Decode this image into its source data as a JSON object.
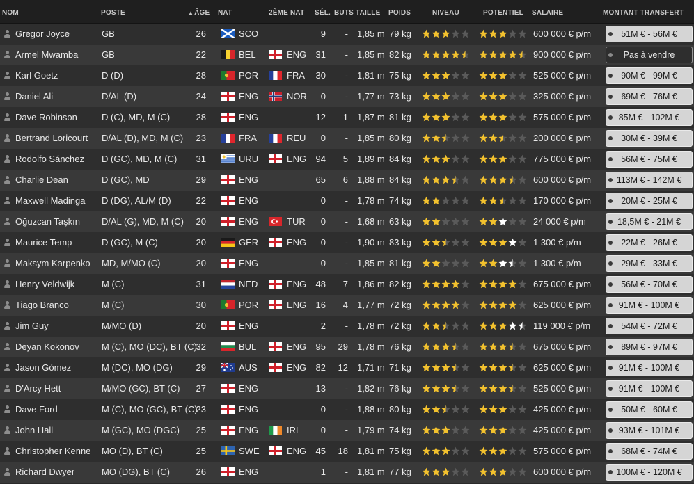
{
  "headers": {
    "nom": "NOM",
    "poste": "POSTE",
    "age": "ÂGE",
    "nat": "NAT",
    "nat2": "2ÈME NAT",
    "sel": "SÉL.",
    "buts": "BUTS",
    "taille": "TAILLE",
    "poids": "POIDS",
    "niveau": "NIVEAU",
    "potentiel": "POTENTIEL",
    "salaire": "SALAIRE",
    "transfert": "MONTANT TRANSFERT"
  },
  "colors": {
    "star": "#f2c12e",
    "star_white": "#ffffff",
    "star_empty": "#5a5a5a"
  },
  "players": [
    {
      "name": "Gregor Joyce",
      "pos": "GB",
      "age": "26",
      "nat": "SCO",
      "nat2": "",
      "sel": "9",
      "buts": "-",
      "taille": "1,85 m",
      "poids": "79 kg",
      "niveau": 3,
      "potentiel": 3,
      "pot_white": 0,
      "salaire": "600 000 € p/m",
      "transfert": "51M € - 56M €"
    },
    {
      "name": "Armel Mwamba",
      "pos": "GB",
      "age": "22",
      "nat": "BEL",
      "nat2": "ENG",
      "sel": "31",
      "buts": "-",
      "taille": "1,85 m",
      "poids": "82 kg",
      "niveau": 4.5,
      "potentiel": 4.5,
      "pot_white": 0,
      "salaire": "900 000 € p/m",
      "transfert": "Pas à vendre"
    },
    {
      "name": "Karl Goetz",
      "pos": "D (D)",
      "age": "28",
      "nat": "POR",
      "nat2": "FRA",
      "sel": "30",
      "buts": "-",
      "taille": "1,81 m",
      "poids": "75 kg",
      "niveau": 3,
      "potentiel": 3,
      "pot_white": 0,
      "salaire": "525 000 € p/m",
      "transfert": "90M € - 99M €"
    },
    {
      "name": "Daniel Ali",
      "pos": "D/AL (D)",
      "age": "24",
      "nat": "ENG",
      "nat2": "NOR",
      "sel": "0",
      "buts": "-",
      "taille": "1,77 m",
      "poids": "73 kg",
      "niveau": 3,
      "potentiel": 3,
      "pot_white": 0,
      "salaire": "325 000 € p/m",
      "transfert": "69M € - 76M €"
    },
    {
      "name": "Dave Robinson",
      "pos": "D (C), MD, M (C)",
      "age": "28",
      "nat": "ENG",
      "nat2": "",
      "sel": "12",
      "buts": "1",
      "taille": "1,87 m",
      "poids": "81 kg",
      "niveau": 3,
      "potentiel": 3,
      "pot_white": 0,
      "salaire": "575 000 € p/m",
      "transfert": "85M € - 102M €"
    },
    {
      "name": "Bertrand Loricourt",
      "pos": "D/AL (D), MD, M (C)",
      "age": "23",
      "nat": "FRA",
      "nat2": "REU",
      "sel": "0",
      "buts": "-",
      "taille": "1,85 m",
      "poids": "80 kg",
      "niveau": 2.5,
      "potentiel": 2.5,
      "pot_white": 0,
      "salaire": "200 000 € p/m",
      "transfert": "30M € - 39M €"
    },
    {
      "name": "Rodolfo Sánchez",
      "pos": "D (GC), MD, M (C)",
      "age": "31",
      "nat": "URU",
      "nat2": "ENG",
      "sel": "94",
      "buts": "5",
      "taille": "1,89 m",
      "poids": "84 kg",
      "niveau": 3,
      "potentiel": 3,
      "pot_white": 0,
      "salaire": "775 000 € p/m",
      "transfert": "56M € - 75M €"
    },
    {
      "name": "Charlie Dean",
      "pos": "D (GC), MD",
      "age": "29",
      "nat": "ENG",
      "nat2": "",
      "sel": "65",
      "buts": "6",
      "taille": "1,88 m",
      "poids": "84 kg",
      "niveau": 3.5,
      "potentiel": 3.5,
      "pot_white": 0,
      "salaire": "600 000 € p/m",
      "transfert": "113M € - 142M €"
    },
    {
      "name": "Maxwell Madinga",
      "pos": "D (DG), AL/M (D)",
      "age": "22",
      "nat": "ENG",
      "nat2": "",
      "sel": "0",
      "buts": "-",
      "taille": "1,78 m",
      "poids": "74 kg",
      "niveau": 2,
      "potentiel": 2.5,
      "pot_white": 0,
      "salaire": "170 000 € p/m",
      "transfert": "20M € - 25M €"
    },
    {
      "name": "Oğuzcan Taşkın",
      "pos": "D/AL (G), MD, M (C)",
      "age": "20",
      "nat": "ENG",
      "nat2": "TUR",
      "sel": "0",
      "buts": "-",
      "taille": "1,68 m",
      "poids": "63 kg",
      "niveau": 2,
      "potentiel": 2,
      "pot_white": 1,
      "salaire": "24 000 € p/m",
      "transfert": "18,5M € - 21M €"
    },
    {
      "name": "Maurice Temp",
      "pos": "D (GC), M (C)",
      "age": "20",
      "nat": "GER",
      "nat2": "ENG",
      "sel": "0",
      "buts": "-",
      "taille": "1,90 m",
      "poids": "83 kg",
      "niveau": 2.5,
      "potentiel": 3,
      "pot_white": 1,
      "salaire": "1 300 € p/m",
      "transfert": "22M € - 26M €"
    },
    {
      "name": "Maksym Karpenko",
      "pos": "MD, M/MO (C)",
      "age": "20",
      "nat": "ENG",
      "nat2": "",
      "sel": "0",
      "buts": "-",
      "taille": "1,85 m",
      "poids": "81 kg",
      "niveau": 2,
      "potentiel": 2,
      "pot_white": 1.5,
      "salaire": "1 300 € p/m",
      "transfert": "29M € - 33M €"
    },
    {
      "name": "Henry Veldwijk",
      "pos": "M (C)",
      "age": "31",
      "nat": "NED",
      "nat2": "ENG",
      "sel": "48",
      "buts": "7",
      "taille": "1,86 m",
      "poids": "82 kg",
      "niveau": 4,
      "potentiel": 4,
      "pot_white": 0,
      "salaire": "675 000 € p/m",
      "transfert": "56M € - 70M €"
    },
    {
      "name": "Tiago Branco",
      "pos": "M (C)",
      "age": "30",
      "nat": "POR",
      "nat2": "ENG",
      "sel": "16",
      "buts": "4",
      "taille": "1,77 m",
      "poids": "72 kg",
      "niveau": 4,
      "potentiel": 4,
      "pot_white": 0,
      "salaire": "625 000 € p/m",
      "transfert": "91M € - 100M €"
    },
    {
      "name": "Jim Guy",
      "pos": "M/MO (D)",
      "age": "20",
      "nat": "ENG",
      "nat2": "",
      "sel": "2",
      "buts": "-",
      "taille": "1,78 m",
      "poids": "72 kg",
      "niveau": 2.5,
      "potentiel": 3,
      "pot_white": 1.5,
      "salaire": "119 000 € p/m",
      "transfert": "54M € - 72M €"
    },
    {
      "name": "Deyan Kokonov",
      "pos": "M (C), MO (DC), BT (C)",
      "age": "32",
      "nat": "BUL",
      "nat2": "ENG",
      "sel": "95",
      "buts": "29",
      "taille": "1,78 m",
      "poids": "76 kg",
      "niveau": 3.5,
      "potentiel": 3.5,
      "pot_white": 0,
      "salaire": "675 000 € p/m",
      "transfert": "89M € - 97M €"
    },
    {
      "name": "Jason Gómez",
      "pos": "M (DC), MO (DG)",
      "age": "29",
      "nat": "AUS",
      "nat2": "ENG",
      "sel": "82",
      "buts": "12",
      "taille": "1,71 m",
      "poids": "71 kg",
      "niveau": 3.5,
      "potentiel": 3.5,
      "pot_white": 0,
      "salaire": "625 000 € p/m",
      "transfert": "91M € - 100M €"
    },
    {
      "name": "D'Arcy Hett",
      "pos": "M/MO (GC), BT (C)",
      "age": "27",
      "nat": "ENG",
      "nat2": "",
      "sel": "13",
      "buts": "-",
      "taille": "1,82 m",
      "poids": "76 kg",
      "niveau": 3.5,
      "potentiel": 3.5,
      "pot_white": 0,
      "salaire": "525 000 € p/m",
      "transfert": "91M € - 100M €"
    },
    {
      "name": "Dave Ford",
      "pos": "M (C), MO (GC), BT (C)",
      "age": "23",
      "nat": "ENG",
      "nat2": "",
      "sel": "0",
      "buts": "-",
      "taille": "1,88 m",
      "poids": "80 kg",
      "niveau": 2.5,
      "potentiel": 3,
      "pot_white": 0,
      "salaire": "425 000 € p/m",
      "transfert": "50M € - 60M €"
    },
    {
      "name": "John Hall",
      "pos": "M (GC), MO (DGC)",
      "age": "25",
      "nat": "ENG",
      "nat2": "IRL",
      "sel": "0",
      "buts": "-",
      "taille": "1,79 m",
      "poids": "74 kg",
      "niveau": 3,
      "potentiel": 3,
      "pot_white": 0,
      "salaire": "425 000 € p/m",
      "transfert": "93M € - 101M €"
    },
    {
      "name": "Christopher Kenne",
      "pos": "MO (D), BT (C)",
      "age": "25",
      "nat": "SWE",
      "nat2": "ENG",
      "sel": "45",
      "buts": "18",
      "taille": "1,81 m",
      "poids": "75 kg",
      "niveau": 3,
      "potentiel": 3,
      "pot_white": 0,
      "salaire": "575 000 € p/m",
      "transfert": "68M € - 74M €"
    },
    {
      "name": "Richard Dwyer",
      "pos": "MO (DG), BT (C)",
      "age": "26",
      "nat": "ENG",
      "nat2": "",
      "sel": "1",
      "buts": "-",
      "taille": "1,81 m",
      "poids": "77 kg",
      "niveau": 3,
      "potentiel": 3,
      "pot_white": 0,
      "salaire": "600 000 € p/m",
      "transfert": "100M € - 120M €"
    }
  ]
}
